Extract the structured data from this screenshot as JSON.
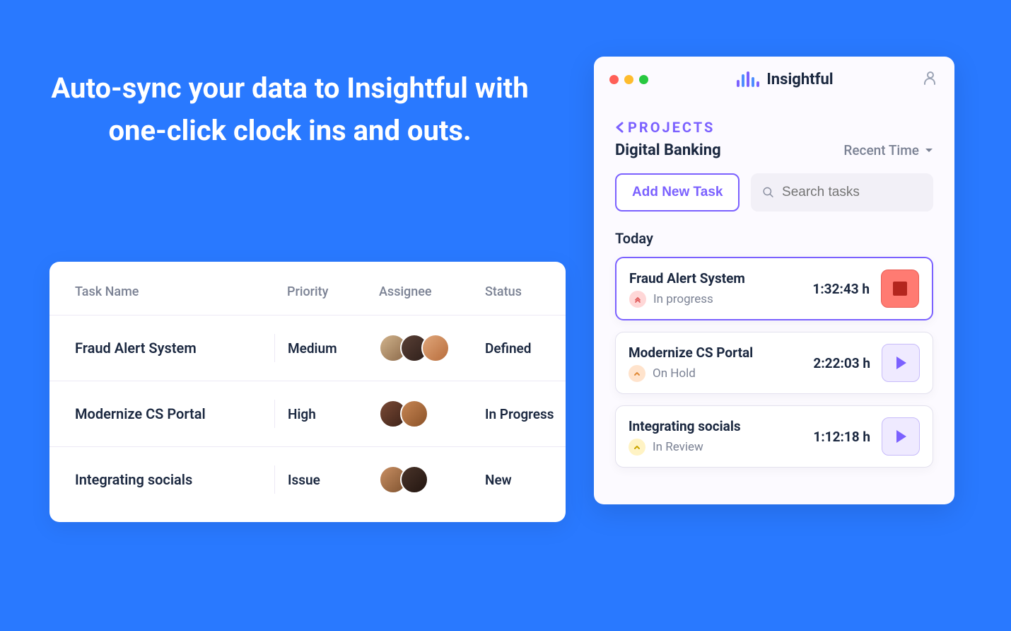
{
  "headline": "Auto-sync your data to Insightful with one-click clock ins and outs.",
  "table": {
    "headers": {
      "name": "Task Name",
      "priority": "Priority",
      "assignee": "Assignee",
      "status": "Status"
    },
    "rows": [
      {
        "name": "Fraud Alert System",
        "priority": "Medium",
        "assignee_count": 3,
        "status": "Defined"
      },
      {
        "name": "Modernize CS Portal",
        "priority": "High",
        "assignee_count": 2,
        "status": "In Progress"
      },
      {
        "name": "Integrating socials",
        "priority": "Issue",
        "assignee_count": 2,
        "status": "New"
      }
    ]
  },
  "app": {
    "brand": "Insightful",
    "crumb_label": "PROJECTS",
    "project_title": "Digital Banking",
    "sort_label": "Recent Time",
    "add_task_label": "Add New Task",
    "search_placeholder": "Search tasks",
    "section_label": "Today",
    "tasks": [
      {
        "name": "Fraud Alert System",
        "status": "In progress",
        "time": "1:32:43 h",
        "chip": "red",
        "control": "stop",
        "active": true
      },
      {
        "name": "Modernize CS Portal",
        "status": "On Hold",
        "time": "2:22:03 h",
        "chip": "orange",
        "control": "play",
        "active": false
      },
      {
        "name": "Integrating socials",
        "status": "In Review",
        "time": "1:12:18 h",
        "chip": "yellow",
        "control": "play",
        "active": false
      }
    ]
  },
  "colors": {
    "accent": "#7b61ff",
    "bg": "#2979ff"
  }
}
